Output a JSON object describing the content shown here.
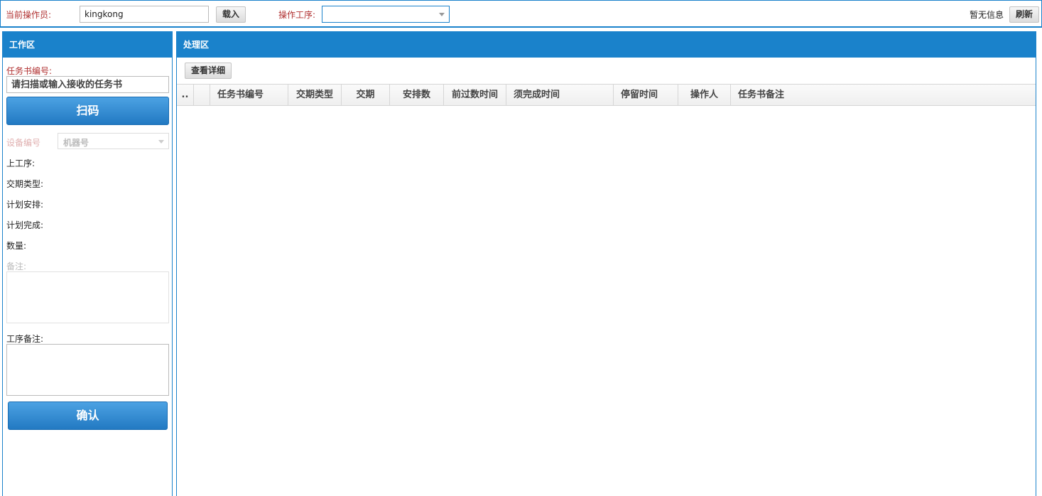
{
  "topbar": {
    "operator_label": "当前操作员:",
    "operator_value": "kingkong",
    "load_label": "载入",
    "process_label": "操作工序:",
    "process_value": "",
    "info_text": "暂无信息",
    "refresh_label": "刷新"
  },
  "work_area": {
    "title": "工作区",
    "task_no_label": "任务书编号:",
    "task_no_placeholder": "请扫描或输入接收的任务书",
    "scan_label": "扫码",
    "device_label": "设备编号",
    "device_placeholder": "机器号",
    "fields": [
      "上工序:",
      "交期类型:",
      "计划安排:",
      "计划完成:",
      "数量:"
    ],
    "remark_label": "备注:",
    "process_remark_label": "工序备注:",
    "confirm_label": "确认"
  },
  "process_area": {
    "title": "处理区",
    "detail_button_label": "查看详细",
    "columns": [
      "..",
      "",
      "任务书编号",
      "交期类型",
      "交期",
      "安排数",
      "前过数时间",
      "须完成时间",
      "停留时间",
      "操作人",
      "任务书备注"
    ],
    "rows": []
  },
  "colors": {
    "accent": "#1a82cb",
    "label_red": "#b03030"
  }
}
